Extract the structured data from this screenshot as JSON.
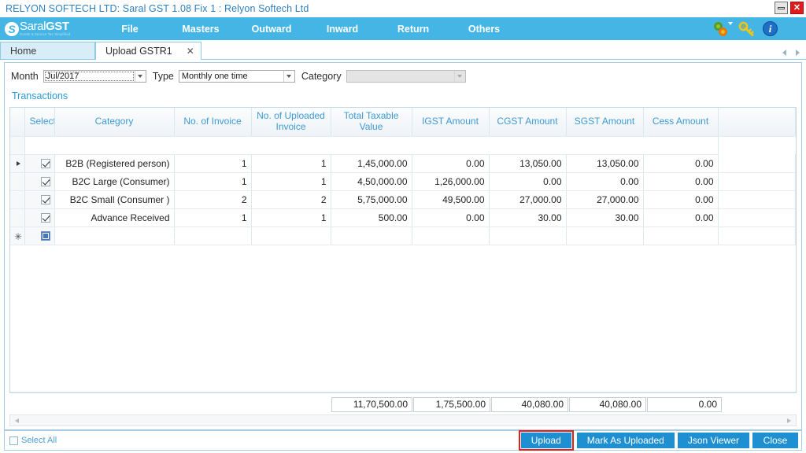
{
  "window": {
    "title": "RELYON SOFTECH LTD: Saral GST  1.08 Fix 1 : Relyon Softech Ltd",
    "minimize_label": "Minimize",
    "close_label": "✕"
  },
  "brand": {
    "badge": "S",
    "name_light": "Saral",
    "name_bold": "GST",
    "tagline": "Goods & Service Tax Simplified"
  },
  "menu": {
    "items": [
      {
        "label": "File"
      },
      {
        "label": "Masters"
      },
      {
        "label": "Outward"
      },
      {
        "label": "Inward"
      },
      {
        "label": "Return"
      },
      {
        "label": "Others"
      }
    ],
    "icons": [
      {
        "name": "settings-gears-icon"
      },
      {
        "name": "key-icon"
      },
      {
        "name": "info-icon",
        "glyph": "i"
      }
    ]
  },
  "tabs": [
    {
      "label": "Home",
      "active": false,
      "closable": false
    },
    {
      "label": "Upload GSTR1",
      "active": true,
      "closable": true,
      "close_glyph": "✕"
    }
  ],
  "filters": {
    "month_label": "Month",
    "month_value": "Jul/2017",
    "type_label": "Type",
    "type_value": "Monthly one time",
    "category_label": "Category",
    "category_value": "",
    "category_disabled": true
  },
  "section": {
    "transactions_label": "Transactions"
  },
  "grid": {
    "columns": [
      "Select",
      "Category",
      "No. of Invoice",
      "No. of Uploaded Invoice",
      "Total Taxable Value",
      "IGST Amount",
      "CGST Amount",
      "SGST Amount",
      "Cess Amount"
    ],
    "rows": [
      {
        "selected": true,
        "current": true,
        "category": "B2B (Registered person)",
        "invoices": "1",
        "uploaded": "1",
        "taxable": "1,45,000.00",
        "igst": "0.00",
        "cgst": "13,050.00",
        "sgst": "13,050.00",
        "cess": "0.00"
      },
      {
        "selected": true,
        "current": false,
        "category": "B2C Large (Consumer)",
        "invoices": "1",
        "uploaded": "1",
        "taxable": "4,50,000.00",
        "igst": "1,26,000.00",
        "cgst": "0.00",
        "sgst": "0.00",
        "cess": "0.00"
      },
      {
        "selected": true,
        "current": false,
        "category": "B2C Small (Consumer )",
        "invoices": "2",
        "uploaded": "2",
        "taxable": "5,75,000.00",
        "igst": "49,500.00",
        "cgst": "27,000.00",
        "sgst": "27,000.00",
        "cess": "0.00"
      },
      {
        "selected": true,
        "current": false,
        "category": "Advance Received",
        "invoices": "1",
        "uploaded": "1",
        "taxable": "500.00",
        "igst": "0.00",
        "cgst": "30.00",
        "sgst": "30.00",
        "cess": "0.00"
      }
    ],
    "new_row_marker": "✳"
  },
  "totals": {
    "taxable": "11,70,500.00",
    "igst": "1,75,500.00",
    "cgst": "40,080.00",
    "sgst": "40,080.00",
    "cess": "0.00"
  },
  "footer": {
    "select_all_label": "Select All",
    "select_all_checked": false,
    "buttons": [
      {
        "label": "Upload",
        "highlighted": true
      },
      {
        "label": "Mark As Uploaded",
        "highlighted": false
      },
      {
        "label": "Json Viewer",
        "highlighted": false
      },
      {
        "label": "Close",
        "highlighted": false
      }
    ]
  },
  "colors": {
    "brand_blue": "#44b5e4",
    "button_blue": "#1e90d2",
    "header_text": "#3d9ad4",
    "highlight_red": "#e41d1d"
  }
}
